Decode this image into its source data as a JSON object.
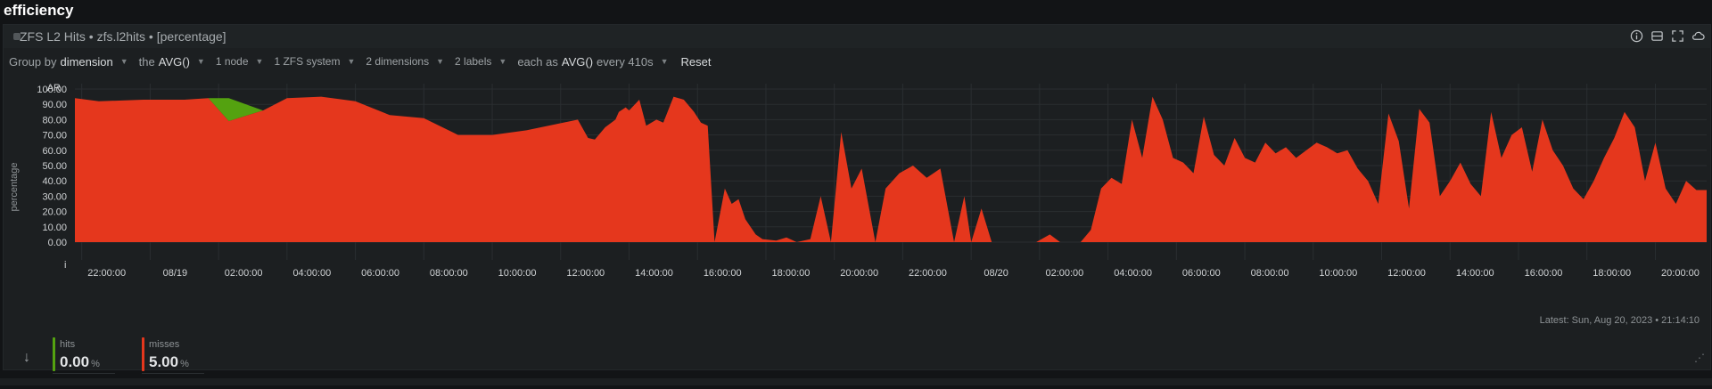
{
  "section": {
    "title": "efficiency"
  },
  "panel": {
    "title": "ZFS L2 Hits • zfs.l2hits • [percentage]",
    "icons": [
      "info-icon",
      "dashboard-icon",
      "expand-icon",
      "cloud-icon"
    ]
  },
  "toolbar": {
    "group_by_label": "Group by",
    "group_by_value": "dimension",
    "the_label": "the",
    "the_value": "AVG()",
    "nodes": "1 node",
    "system": "1 ZFS system",
    "dimensions": "2 dimensions",
    "labels": "2 labels",
    "each_as_label": "each as",
    "each_as_value": "AVG()",
    "every": "every 410s",
    "reset": "Reset"
  },
  "chart_data": {
    "type": "area",
    "stacked": true,
    "ylabel": "percentage",
    "ylim": [
      0,
      100
    ],
    "yticks": [
      "100.00",
      "90.00",
      "80.00",
      "70.00",
      "60.00",
      "50.00",
      "40.00",
      "30.00",
      "20.00",
      "10.00",
      "0.00"
    ],
    "y_top_label": "AR",
    "y_bottom_label": "i",
    "xticks": [
      "22:00:00",
      "08/19",
      "02:00:00",
      "04:00:00",
      "06:00:00",
      "08:00:00",
      "10:00:00",
      "12:00:00",
      "14:00:00",
      "16:00:00",
      "18:00:00",
      "20:00:00",
      "22:00:00",
      "08/20",
      "02:00:00",
      "04:00:00",
      "06:00:00",
      "08:00:00",
      "10:00:00",
      "12:00:00",
      "14:00:00",
      "16:00:00",
      "18:00:00",
      "20:00:00"
    ],
    "x_range_hours": [
      -0.2,
      47.5
    ],
    "grid": true,
    "colors": {
      "hits": "#54a210",
      "misses": "#e5371d"
    },
    "x_hours": [
      -0.2,
      0.5,
      1.8,
      3.0,
      3.7,
      4.3,
      5.3,
      6.0,
      7.0,
      8.0,
      9.0,
      10.0,
      11.0,
      12.0,
      13.0,
      14.5,
      14.8,
      15.0,
      15.3,
      15.6,
      15.7,
      15.9,
      16.0,
      16.3,
      16.5,
      16.8,
      17.0,
      17.3,
      17.6,
      17.9,
      18.1,
      18.3,
      18.5,
      18.8,
      19.0,
      19.2,
      19.4,
      19.7,
      19.9,
      20.3,
      20.6,
      20.9,
      21.3,
      21.6,
      21.9,
      22.2,
      22.5,
      22.8,
      23.2,
      23.5,
      23.9,
      24.3,
      24.7,
      25.1,
      25.5,
      25.8,
      26.0,
      26.3,
      26.6,
      27.0,
      27.3,
      27.6,
      27.9,
      28.3,
      28.6,
      28.9,
      29.2,
      29.5,
      29.8,
      30.1,
      30.4,
      30.7,
      31.0,
      31.3,
      31.6,
      31.9,
      32.2,
      32.5,
      32.8,
      33.1,
      33.4,
      33.7,
      34.0,
      34.3,
      34.6,
      34.9,
      35.2,
      35.5,
      35.8,
      36.1,
      36.4,
      36.7,
      37.0,
      37.3,
      37.6,
      37.9,
      38.2,
      38.5,
      38.8,
      39.1,
      39.4,
      39.7,
      40.0,
      40.3,
      40.6,
      40.9,
      41.2,
      41.5,
      41.8,
      42.1,
      42.4,
      42.7,
      43.0,
      43.3,
      43.6,
      43.9,
      44.2,
      44.5,
      44.8,
      45.1,
      45.4,
      45.7,
      46.0,
      46.3,
      46.6,
      46.9,
      47.2,
      47.5
    ],
    "series": [
      {
        "name": "hits",
        "values": [
          0,
          0,
          0,
          0,
          0,
          15,
          0,
          0,
          0,
          0,
          0,
          0,
          0,
          0,
          0,
          0,
          0,
          0,
          0,
          0,
          0,
          0,
          0,
          0,
          0,
          0,
          0,
          0,
          0,
          0,
          0,
          0,
          0,
          0,
          0,
          0,
          0,
          0,
          0,
          0,
          0,
          0,
          0,
          0,
          0,
          0,
          0,
          0,
          0,
          0,
          0,
          0,
          0,
          0,
          0,
          0,
          0,
          0,
          0,
          0,
          0,
          0,
          0,
          0,
          0,
          0,
          0,
          0,
          0,
          0,
          0,
          0,
          0,
          0,
          0,
          0,
          0,
          0,
          0,
          0,
          0,
          0,
          0,
          0,
          0,
          0,
          0,
          0,
          0,
          0,
          0,
          0,
          0,
          0,
          0,
          0,
          0,
          0,
          0,
          0,
          0,
          0,
          0,
          0,
          0,
          0,
          0,
          0,
          0,
          0,
          0,
          0,
          0,
          0,
          0,
          0,
          0,
          0,
          0,
          0,
          0,
          0,
          0,
          0,
          0,
          0,
          0,
          0
        ]
      },
      {
        "name": "misses",
        "values": [
          94,
          92,
          93,
          93,
          94,
          79,
          86,
          94,
          95,
          92,
          83,
          81,
          70,
          70,
          73,
          80,
          68,
          67,
          75,
          80,
          85,
          88,
          86,
          93,
          76,
          80,
          78,
          95,
          93,
          85,
          78,
          76,
          0,
          35,
          25,
          28,
          15,
          5,
          2,
          1,
          3,
          0,
          2,
          30,
          0,
          72,
          35,
          48,
          0,
          35,
          45,
          50,
          42,
          48,
          0,
          30,
          0,
          22,
          0,
          0,
          0,
          0,
          0,
          5,
          0,
          0,
          0,
          8,
          35,
          42,
          38,
          80,
          55,
          95,
          80,
          55,
          52,
          45,
          82,
          57,
          50,
          68,
          55,
          52,
          65,
          58,
          62,
          55,
          60,
          65,
          62,
          58,
          60,
          48,
          40,
          25,
          84,
          66,
          22,
          87,
          78,
          30,
          40,
          52,
          38,
          30,
          85,
          55,
          70,
          75,
          46,
          80,
          60,
          50,
          35,
          28,
          40,
          55,
          68,
          85,
          75,
          40,
          65,
          35,
          25,
          40,
          34,
          34
        ]
      }
    ]
  },
  "latest": "Latest: Sun, Aug 20, 2023 • 21:14:10",
  "legend": [
    {
      "name": "hits",
      "value": "0.00",
      "unit": "%",
      "color": "#54a210"
    },
    {
      "name": "misses",
      "value": "5.00",
      "unit": "%",
      "color": "#e5371d"
    }
  ]
}
